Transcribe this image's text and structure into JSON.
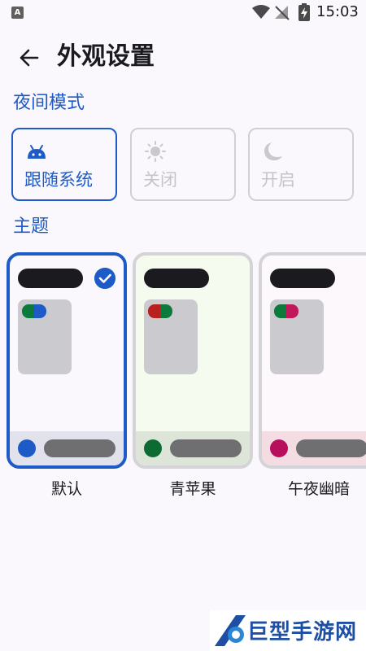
{
  "status_bar": {
    "time": "15:03",
    "icons": [
      "a-app-icon",
      "wifi-icon",
      "no-signal-icon",
      "battery-charging-icon"
    ],
    "a_glyph": "A"
  },
  "header": {
    "back_icon": "arrow-left-icon",
    "title": "外观设置"
  },
  "night_mode": {
    "section_label": "夜间模式",
    "options": [
      {
        "label": "跟随系统",
        "icon": "android-icon",
        "selected": true
      },
      {
        "label": "关闭",
        "icon": "sun-icon",
        "selected": false
      },
      {
        "label": "开启",
        "icon": "moon-icon",
        "selected": false
      }
    ]
  },
  "themes": {
    "section_label": "主题",
    "items": [
      {
        "label": "默认",
        "selected": true,
        "bg": "#fbf8fd",
        "bottom_bg": "#e1e2ec",
        "dot": "#1e5bc6",
        "swatch": [
          "#0b7a3b",
          "#1e5bc6"
        ]
      },
      {
        "label": "青苹果",
        "selected": false,
        "bg": "#f6fbf0",
        "bottom_bg": "#dde5d8",
        "dot": "#0b6b32",
        "swatch": [
          "#b81f1f",
          "#0b7a3b"
        ]
      },
      {
        "label": "午夜幽暗",
        "selected": false,
        "bg": "#fcf8fc",
        "bottom_bg": "#f3dde3",
        "dot": "#b80f5c",
        "swatch": [
          "#0b7a3b",
          "#c2185b"
        ]
      }
    ]
  },
  "colors": {
    "accent": "#1e5bc6",
    "background": "#fbf8fd"
  },
  "watermark": {
    "text": "巨型手游网"
  }
}
